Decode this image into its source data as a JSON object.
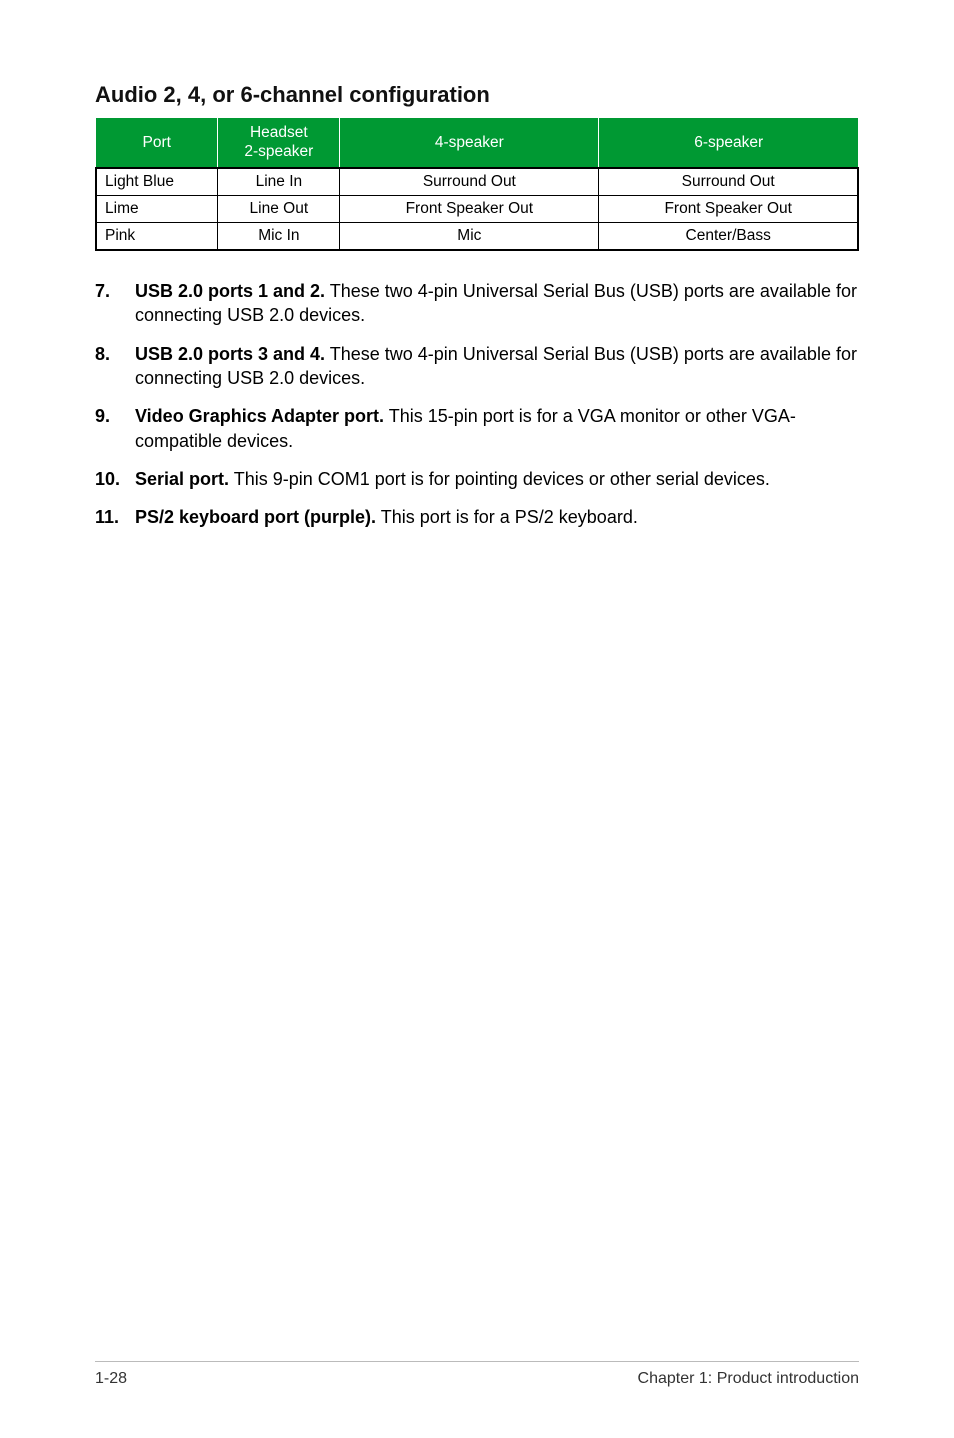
{
  "heading": "Audio 2, 4, or 6-channel configuration",
  "table": {
    "headers": {
      "port": "Port",
      "headset_line1": "Headset",
      "headset_line2": "2-speaker",
      "fourSpk": "4-speaker",
      "sixSpk": "6-speaker"
    },
    "rows": [
      {
        "port": "Light Blue",
        "headset": "Line In",
        "four": "Surround Out",
        "six": "Surround Out"
      },
      {
        "port": "Lime",
        "headset": "Line Out",
        "four": "Front Speaker Out",
        "six": "Front Speaker Out"
      },
      {
        "port": "Pink",
        "headset": "Mic In",
        "four": "Mic",
        "six": "Center/Bass"
      }
    ]
  },
  "items": [
    {
      "num": "7.",
      "bold": "USB 2.0 ports 1 and 2.",
      "rest": " These two 4-pin Universal Serial Bus (USB) ports are available for connecting USB 2.0 devices."
    },
    {
      "num": "8.",
      "bold": "USB 2.0 ports 3 and 4.",
      "rest": " These two 4-pin Universal Serial Bus (USB) ports are available for connecting USB 2.0 devices."
    },
    {
      "num": "9.",
      "bold": "Video Graphics Adapter port.",
      "rest": " This 15-pin port is for a VGA monitor or other VGA-compatible devices."
    },
    {
      "num": "10.",
      "bold": "Serial port.",
      "rest": " This 9-pin COM1 port is for pointing devices or other serial devices."
    },
    {
      "num": "11.",
      "bold": "PS/2 keyboard port (purple).",
      "rest": " This port is for a PS/2 keyboard."
    }
  ],
  "footer": {
    "left": "1-28",
    "right": "Chapter 1: Product introduction"
  }
}
